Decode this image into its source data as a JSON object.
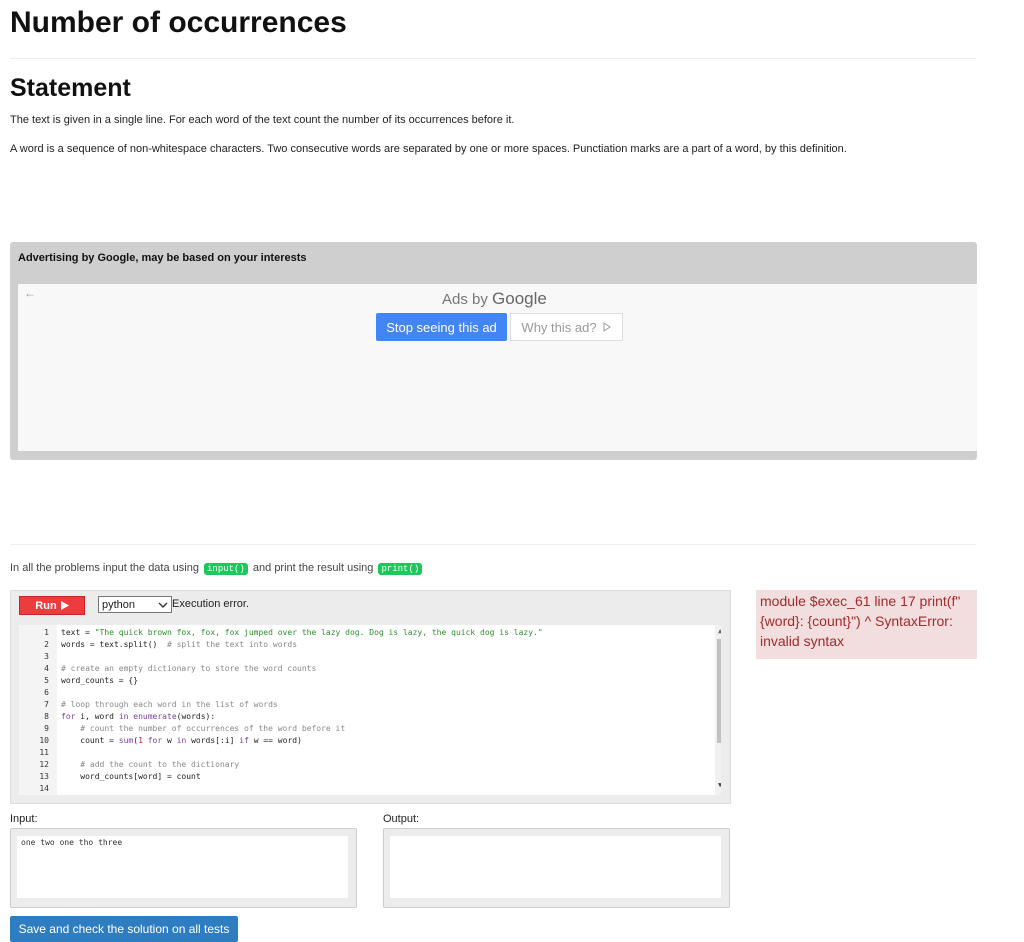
{
  "title": "Number of occurrences",
  "statement": {
    "heading": "Statement",
    "p1": "The text is given in a single line. For each word of the text count the number of its occurrences before it.",
    "p2": "A word is a sequence of non-whitespace characters. Two consecutive words are separated by one or more spaces. Punctiation marks are a part of a word, by this definition."
  },
  "ad": {
    "header": "Advertising by Google, may be based on your interests",
    "back_icon": "arrow-left-icon",
    "ads_by": "Ads by",
    "google": "Google",
    "stop_label": "Stop seeing this ad",
    "why_label": "Why this ad?",
    "why_icon": "play-outline-icon",
    "stop_color": "#4285f4"
  },
  "note": {
    "before": "In all the problems input the data using",
    "input_fn": "input()",
    "middle": "and print the result using",
    "print_fn": "print()"
  },
  "editor": {
    "run_label": "Run",
    "run_icon": "play-icon",
    "language": "python",
    "status": "Execution error.",
    "lines": [
      {
        "n": "1",
        "parts": [
          {
            "t": "text = ",
            "c": ""
          },
          {
            "t": "\"The quick brown fox, fox, fox jumped over the lazy dog. Dog is lazy, the quick dog is lazy.\"",
            "c": "str"
          }
        ]
      },
      {
        "n": "2",
        "parts": [
          {
            "t": "words = text.split()  ",
            "c": ""
          },
          {
            "t": "# split the text into words",
            "c": "cm"
          }
        ]
      },
      {
        "n": "3",
        "parts": []
      },
      {
        "n": "4",
        "parts": [
          {
            "t": "# create an empty dictionary to store the word counts",
            "c": "cm"
          }
        ]
      },
      {
        "n": "5",
        "parts": [
          {
            "t": "word_counts = {}",
            "c": ""
          }
        ]
      },
      {
        "n": "6",
        "parts": []
      },
      {
        "n": "7",
        "parts": [
          {
            "t": "# loop through each word in the list of words",
            "c": "cm"
          }
        ]
      },
      {
        "n": "8",
        "parts": [
          {
            "t": "for",
            "c": "kw"
          },
          {
            "t": " i, word ",
            "c": ""
          },
          {
            "t": "in",
            "c": "kw"
          },
          {
            "t": " ",
            "c": ""
          },
          {
            "t": "enumerate",
            "c": "kw"
          },
          {
            "t": "(words):",
            "c": ""
          }
        ]
      },
      {
        "n": "9",
        "parts": [
          {
            "t": "    # count the number of occurrences of the word before it",
            "c": "cm"
          }
        ]
      },
      {
        "n": "10",
        "parts": [
          {
            "t": "    count = ",
            "c": ""
          },
          {
            "t": "sum",
            "c": "kw"
          },
          {
            "t": "(",
            "c": ""
          },
          {
            "t": "1",
            "c": "num"
          },
          {
            "t": " ",
            "c": ""
          },
          {
            "t": "for",
            "c": "kw"
          },
          {
            "t": " w ",
            "c": ""
          },
          {
            "t": "in",
            "c": "kw"
          },
          {
            "t": " words[:i] ",
            "c": ""
          },
          {
            "t": "if",
            "c": "kw"
          },
          {
            "t": " w == word)",
            "c": ""
          }
        ]
      },
      {
        "n": "11",
        "parts": []
      },
      {
        "n": "12",
        "parts": [
          {
            "t": "    # add the count to the dictionary",
            "c": "cm"
          }
        ]
      },
      {
        "n": "13",
        "parts": [
          {
            "t": "    word_counts[word] = count",
            "c": ""
          }
        ]
      },
      {
        "n": "14",
        "parts": []
      }
    ]
  },
  "error": "module $exec_61 line 17 print(f\" {word}: {count}\") ^ SyntaxError: invalid syntax",
  "io": {
    "input_label": "Input:",
    "input_value": "one two one tho three",
    "output_label": "Output:",
    "output_value": ""
  },
  "save_label": "Save and check the solution on all tests"
}
